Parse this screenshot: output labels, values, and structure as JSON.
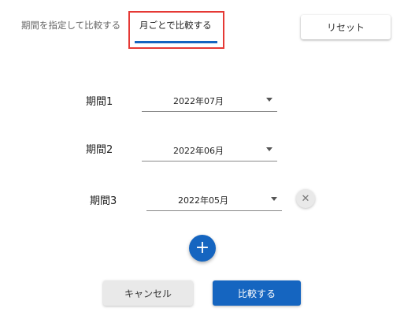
{
  "tabs": {
    "period_compare_label": "期間を指定して比較する",
    "monthly_compare_label": "月ごとで比較する"
  },
  "header": {
    "reset_label": "リセット"
  },
  "periods": [
    {
      "label": "期間1",
      "value": "2022年07月"
    },
    {
      "label": "期間2",
      "value": "2022年06月"
    },
    {
      "label": "期間3",
      "value": "2022年05月"
    }
  ],
  "icons": {
    "remove": "close-icon",
    "add": "plus-icon",
    "dropdown": "caret-down-icon"
  },
  "icon_glyphs": {
    "remove": "✕",
    "add": "+"
  },
  "actions": {
    "cancel_label": "キャンセル",
    "compare_label": "比較する"
  },
  "colors": {
    "accent": "#1565c0",
    "highlight_border": "#e53935"
  }
}
